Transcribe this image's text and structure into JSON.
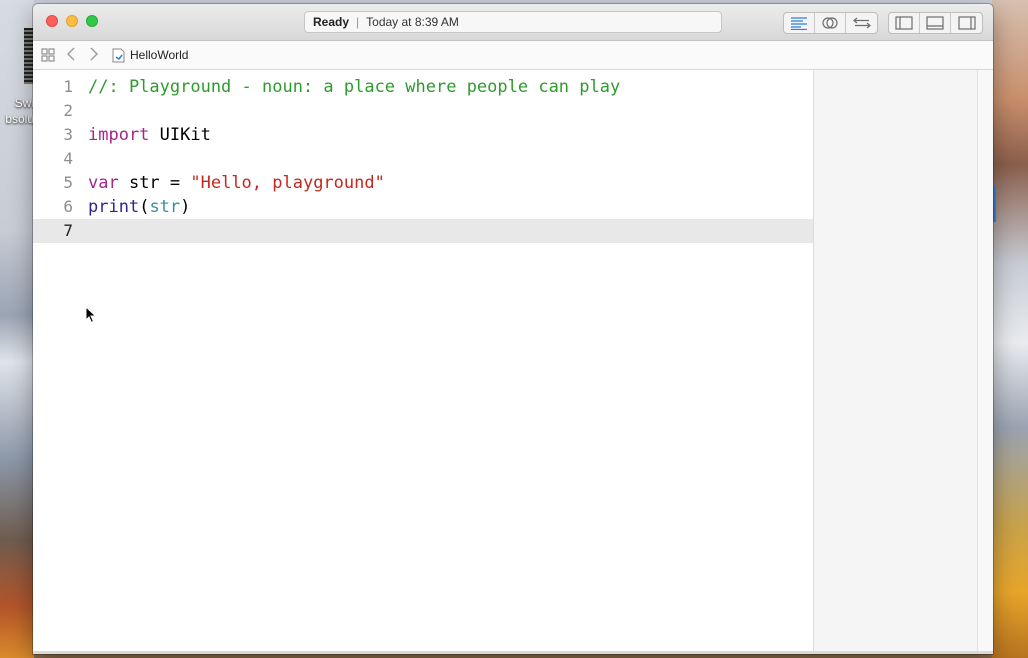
{
  "desktop": {
    "icon_label_line1": "Swi",
    "icon_label_line2": "bsolu"
  },
  "window": {
    "activity": {
      "status": "Ready",
      "separator": "|",
      "time": "Today at 8:39 AM"
    },
    "toolbar": {
      "editor_buttons": [
        "standard-editor-icon",
        "assistant-editor-icon",
        "version-editor-icon"
      ],
      "view_buttons": [
        "navigator-toggle-icon",
        "debug-area-toggle-icon",
        "utilities-toggle-icon"
      ],
      "active_color": "#2f7be6"
    },
    "jumpbar": {
      "file_name": "HelloWorld"
    },
    "editor": {
      "lines": [
        {
          "num": "1",
          "text": "//: Playground - noun: a place where people can play"
        },
        {
          "num": "2",
          "text": ""
        },
        {
          "num": "3",
          "kw": "import",
          "rest": " UIKit"
        },
        {
          "num": "4",
          "text": ""
        },
        {
          "num": "5",
          "kw": "var",
          "mid": " str = ",
          "str": "\"Hello, playground\""
        },
        {
          "num": "6",
          "fn": "print",
          "open": "(",
          "arg": "str",
          "close": ")"
        },
        {
          "num": "7",
          "text": ""
        }
      ],
      "current_line": "7",
      "colors": {
        "comment": "#2e9b2e",
        "keyword": "#a4268a",
        "string": "#c4281e",
        "function": "#2f2593",
        "identifier": "#3e8c9e"
      }
    }
  }
}
